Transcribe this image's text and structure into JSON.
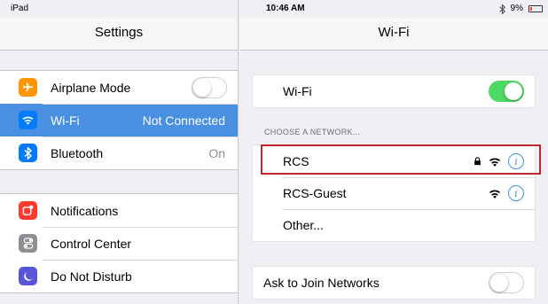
{
  "status_bar": {
    "device": "iPad",
    "time": "10:46 AM",
    "bluetooth": "bluetooth-icon",
    "battery_percent": "9%"
  },
  "left_pane": {
    "title": "Settings",
    "group1": [
      {
        "label": "Airplane Mode",
        "icon": "airplane-icon",
        "icon_color": "#ff9500",
        "control": "toggle",
        "toggle_on": false
      },
      {
        "label": "Wi-Fi",
        "icon": "wifi-icon",
        "icon_color": "#007aff",
        "value": "Not Connected",
        "selected": true
      },
      {
        "label": "Bluetooth",
        "icon": "bluetooth-icon",
        "icon_color": "#007aff",
        "value": "On"
      }
    ],
    "group2": [
      {
        "label": "Notifications",
        "icon": "notifications-icon",
        "icon_color": "#ff3b30"
      },
      {
        "label": "Control Center",
        "icon": "control-center-icon",
        "icon_color": "#8e8e93"
      },
      {
        "label": "Do Not Disturb",
        "icon": "moon-icon",
        "icon_color": "#5856d6"
      }
    ]
  },
  "right_pane": {
    "title": "Wi-Fi",
    "wifi_toggle": {
      "label": "Wi-Fi",
      "toggle_on": true
    },
    "section_header": "CHOOSE A NETWORK...",
    "networks": [
      {
        "name": "RCS",
        "locked": true
      },
      {
        "name": "RCS-Guest",
        "locked": false
      },
      {
        "name": "Other..."
      }
    ],
    "ask_to_join": {
      "label": "Ask to Join Networks",
      "toggle_on": false
    }
  },
  "colors": {
    "selected_row": "#4a90e2",
    "toggle_on": "#4cd964",
    "accent": "#007aff",
    "highlight_box": "#c1272d"
  }
}
